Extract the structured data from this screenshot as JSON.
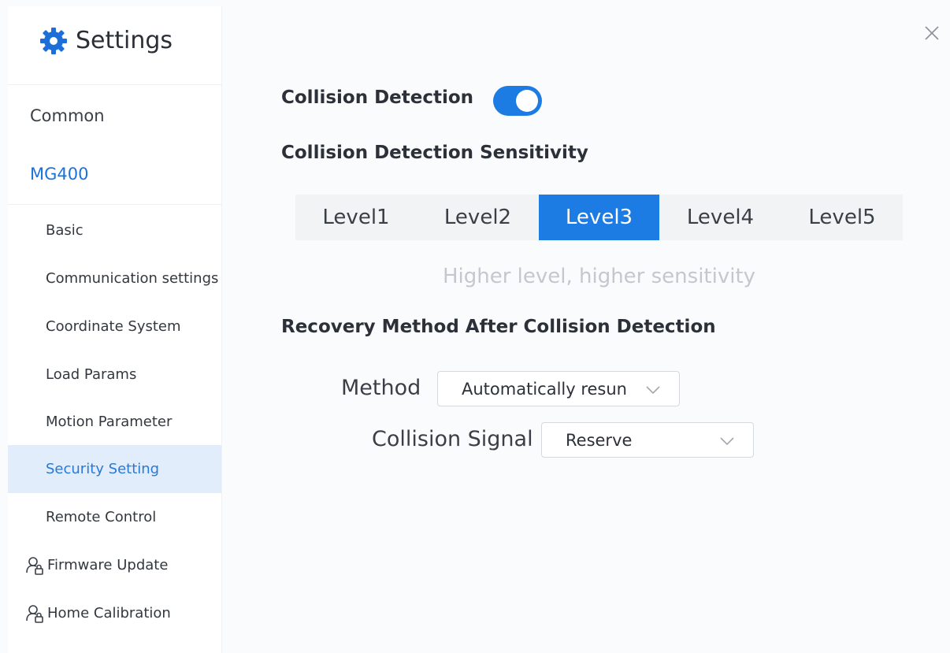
{
  "window": {
    "close_icon": "close-icon"
  },
  "sidebar": {
    "title": "Settings",
    "title_icon": "gear-icon",
    "top_items": [
      {
        "label": "Common",
        "active": false
      },
      {
        "label": "MG400",
        "active": true
      }
    ],
    "sub_items": [
      {
        "label": "Basic"
      },
      {
        "label": "Communication settings"
      },
      {
        "label": "Coordinate System"
      },
      {
        "label": "Load Params"
      },
      {
        "label": "Motion Parameter"
      },
      {
        "label": "Security Setting",
        "selected": true
      },
      {
        "label": "Remote Control"
      }
    ],
    "icon_items": [
      {
        "label": "Firmware Update",
        "icon": "user-lock-icon"
      },
      {
        "label": "Home Calibration",
        "icon": "user-lock-icon"
      }
    ]
  },
  "main": {
    "collision_detection": {
      "label": "Collision Detection",
      "enabled": true
    },
    "sensitivity": {
      "label": "Collision Detection Sensitivity",
      "levels": [
        "Level1",
        "Level2",
        "Level3",
        "Level4",
        "Level5"
      ],
      "selected": "Level3",
      "hint": "Higher level, higher sensitivity"
    },
    "recovery": {
      "label": "Recovery Method After Collision Detection",
      "method_label": "Method",
      "method_value": "Automatically resun",
      "signal_label": "Collision Signal",
      "signal_value": "Reserve"
    }
  },
  "colors": {
    "accent": "#1c7ce4",
    "selected_bg": "#e1edfb",
    "hint": "#c4c8ce"
  }
}
